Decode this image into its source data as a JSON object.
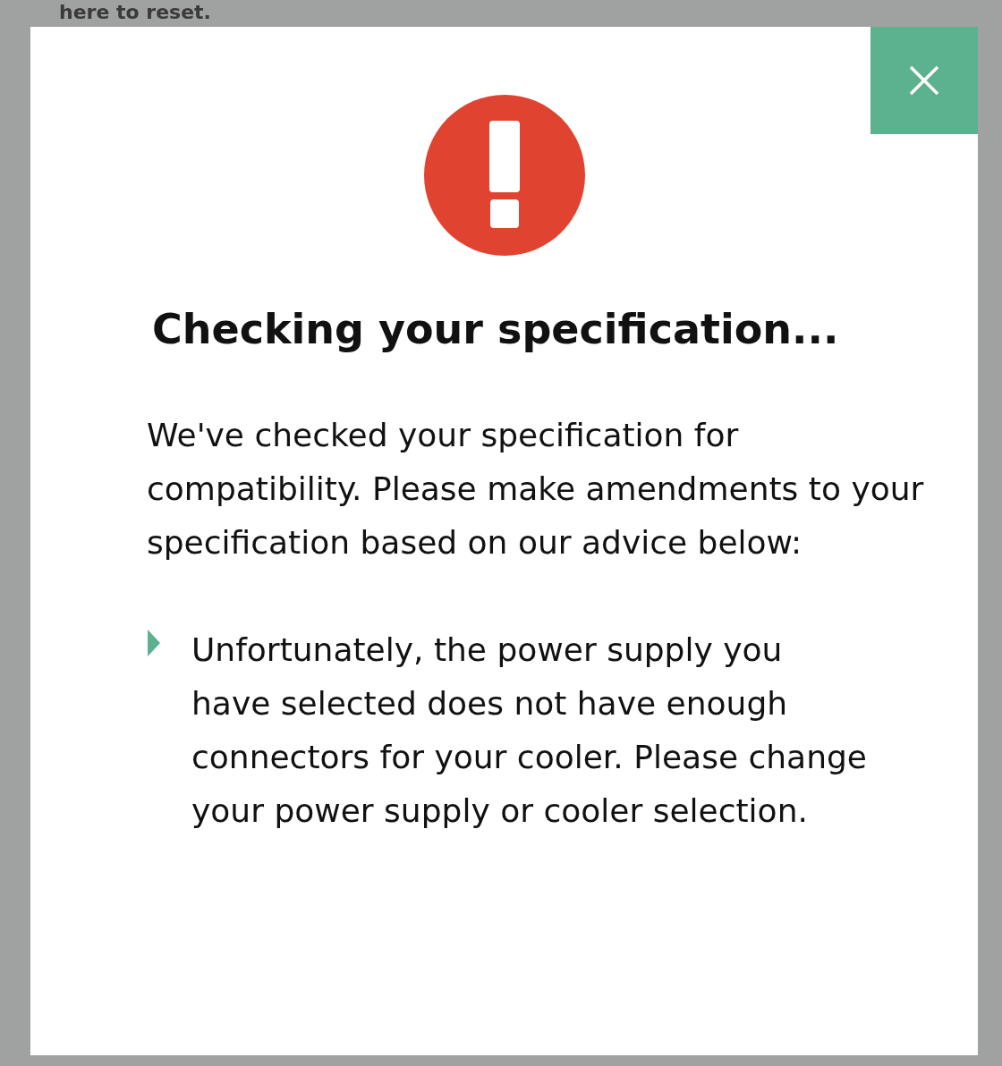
{
  "background_text": "here to reset.",
  "dialog": {
    "title": "Checking your specification...",
    "intro": "We've checked your specification for compatibility. Please make amendments to your specification based on our advice below:",
    "advice": [
      "Unfortunately, the power supply you have selected does not have enough connectors for your cooler. Please change your power supply or cooler selection."
    ]
  }
}
